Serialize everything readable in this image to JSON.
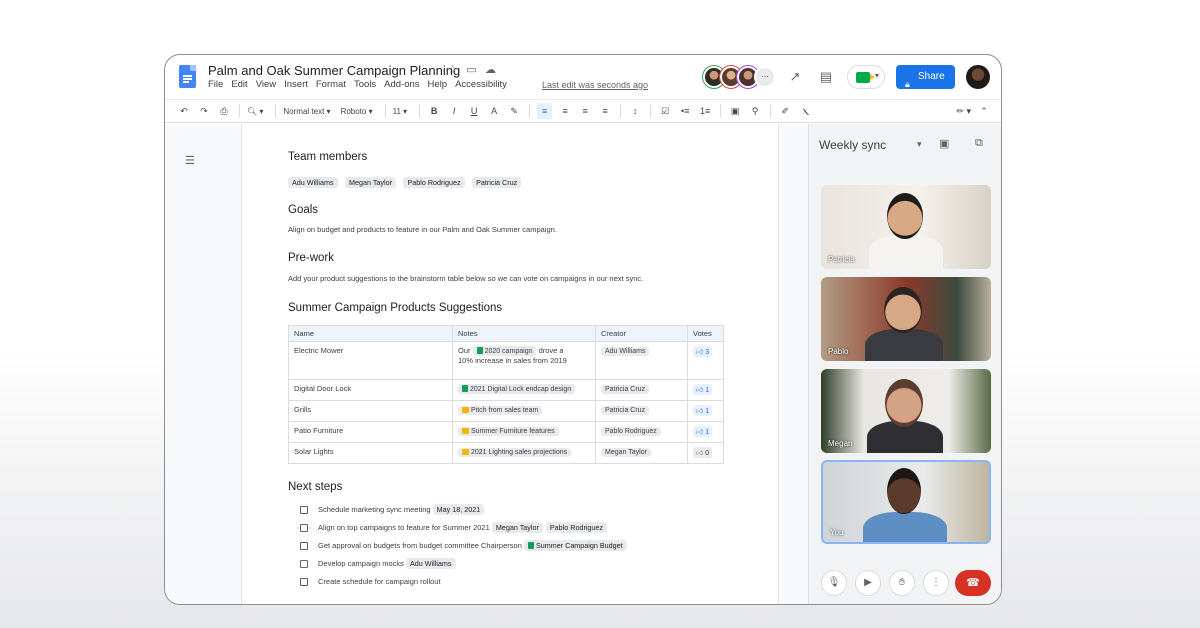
{
  "app": {
    "title": "Palm and Oak Summer Campaign Planning",
    "menus": [
      "File",
      "Edit",
      "View",
      "Insert",
      "Format",
      "Tools",
      "Add-ons",
      "Help",
      "Accessibility"
    ],
    "last_edit": "Last edit was seconds ago",
    "share_label": "Share",
    "accent_color": "#1a73e8"
  },
  "toolbar": {
    "style": "Normal text",
    "font": "Roboto",
    "font_size": "11"
  },
  "doc": {
    "team_heading": "Team members",
    "team": [
      "Adu Williams",
      "Megan Taylor",
      "Pablo Rodriguez",
      "Patricia Cruz"
    ],
    "goals_heading": "Goals",
    "goals_text": "Align on budget and products to feature in our Palm and Oak Summer campaign.",
    "prework_heading": "Pre-work",
    "prework_text": "Add your product suggestions to the brainstorm table below so we can vote on campaigns in our next sync.",
    "table_heading": "Summer Campaign Products Suggestions",
    "table_headers": [
      "Name",
      "Notes",
      "Creator",
      "Votes"
    ],
    "rows": [
      {
        "name": "Electric Mower",
        "note_pre": "Our",
        "note_chip": "2020 campaign",
        "note_post": "drove a",
        "note_line2": "10% increase in sales from 2019",
        "creator": "Adu Williams",
        "votes": "3"
      },
      {
        "name": "Digital Door Lock",
        "note_chip": "2021 Digital Lock endcap design",
        "creator": "Patricia Cruz",
        "votes": "1"
      },
      {
        "name": "Grills",
        "note_chip": "Pitch from sales team",
        "creator": "Patricia Cruz",
        "votes": "1"
      },
      {
        "name": "Patio Furniture",
        "note_chip": "Summer Furniture features",
        "creator": "Pablo Rodriguez",
        "votes": "1"
      },
      {
        "name": "Solar Lights",
        "note_chip": "2021 Lighting sales projections",
        "creator": "Megan Taylor",
        "votes": "0"
      }
    ],
    "next_heading": "Next steps",
    "steps": [
      {
        "text": "Schedule marketing sync meeting",
        "chip1": "May 18, 2021"
      },
      {
        "text": "Align on top campaigns to feature for Summer 2021",
        "chip1": "Megan Taylor",
        "chip2": "Pablo Rodriguez"
      },
      {
        "text": "Get approval on budgets from budget committee Chairperson",
        "chip1": "Summer Campaign Budget"
      },
      {
        "text": "Develop campaign mocks",
        "chip1": "Adu Williams"
      },
      {
        "text": "Create schedule for campaign rollout"
      }
    ]
  },
  "meet": {
    "title": "Weekly sync",
    "participants": [
      "Patricia",
      "Pablo",
      "Megan",
      "You"
    ]
  }
}
